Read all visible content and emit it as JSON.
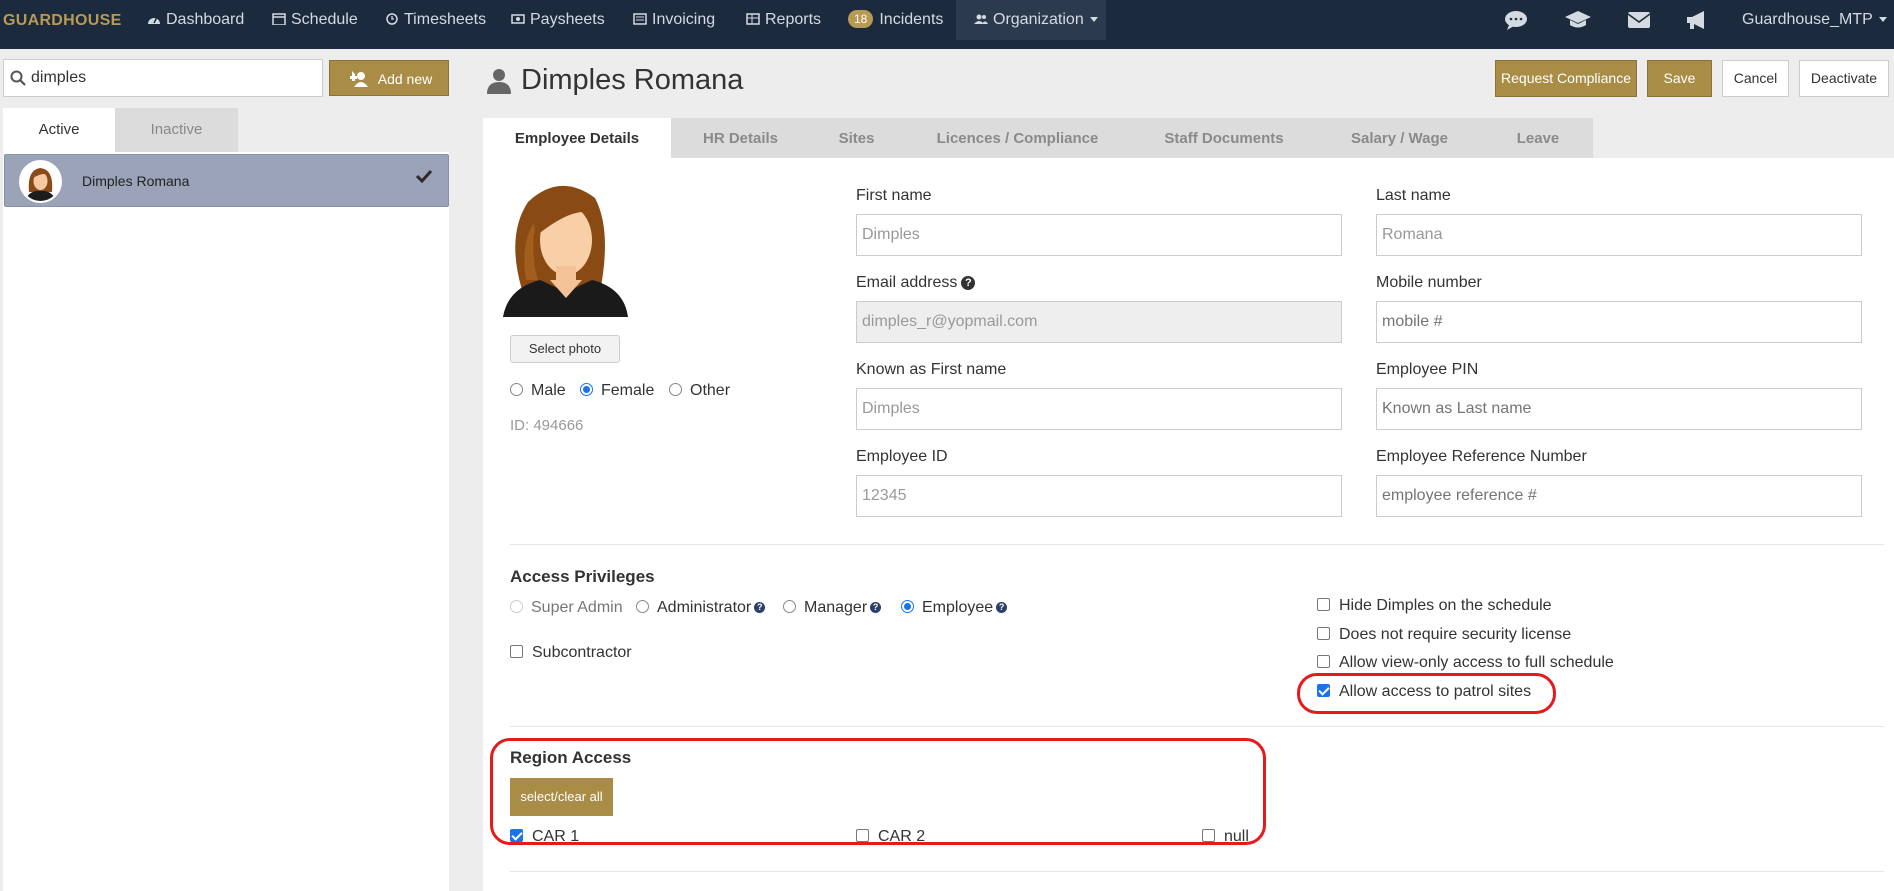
{
  "nav": {
    "brand": "GUARDHOUSE",
    "items": [
      {
        "label": "Dashboard",
        "icon": "dashboard-icon"
      },
      {
        "label": "Schedule",
        "icon": "calendar-icon"
      },
      {
        "label": "Timesheets",
        "icon": "clock-icon"
      },
      {
        "label": "Paysheets",
        "icon": "money-icon"
      },
      {
        "label": "Invoicing",
        "icon": "invoice-icon"
      },
      {
        "label": "Reports",
        "icon": "table-icon"
      },
      {
        "label": "Incidents",
        "badge": "18"
      },
      {
        "label": "Organization",
        "icon": "users-icon"
      }
    ],
    "right_icons": [
      "chat-icon",
      "graduation-cap-icon",
      "envelope-icon",
      "megaphone-icon"
    ],
    "account": "Guardhouse_MTP"
  },
  "left": {
    "search_value": "dimples",
    "add_new": "Add new",
    "tabs": {
      "active": "Active",
      "inactive": "Inactive"
    },
    "employees": [
      {
        "name": "Dimples Romana",
        "selected": true
      }
    ]
  },
  "header": {
    "title": "Dimples Romana",
    "buttons": {
      "request_compliance": "Request Compliance",
      "save": "Save",
      "cancel": "Cancel",
      "deactivate": "Deactivate"
    }
  },
  "tabs": [
    "Employee Details",
    "HR Details",
    "Sites",
    "Licences / Compliance",
    "Staff Documents",
    "Salary / Wage",
    "Leave"
  ],
  "profile": {
    "select_photo": "Select photo",
    "gender": {
      "male": "Male",
      "female": "Female",
      "other": "Other",
      "selected": "Female"
    },
    "id_text": "ID: 494666"
  },
  "form": {
    "first_name": {
      "label": "First name",
      "value": "Dimples"
    },
    "last_name": {
      "label": "Last name",
      "value": "Romana"
    },
    "email": {
      "label": "Email address",
      "value": "dimples_r@yopmail.com"
    },
    "mobile": {
      "label": "Mobile number",
      "placeholder": "mobile #"
    },
    "known_first": {
      "label": "Known as First name",
      "value": "Dimples"
    },
    "pin": {
      "label": "Employee PIN",
      "placeholder": "Known as Last name"
    },
    "employee_id": {
      "label": "Employee ID",
      "value": "12345"
    },
    "reference": {
      "label": "Employee Reference Number",
      "placeholder": "employee reference #"
    }
  },
  "access": {
    "title": "Access Privileges",
    "roles": {
      "super_admin": "Super Admin",
      "administrator": "Administrator",
      "manager": "Manager",
      "employee": "Employee",
      "selected": "Employee"
    },
    "subcontractor": "Subcontractor",
    "options": {
      "hide_schedule": "Hide Dimples on the schedule",
      "no_license": "Does not require security license",
      "view_only": "Allow view-only access to full schedule",
      "patrol": "Allow access to patrol sites"
    }
  },
  "region": {
    "title": "Region Access",
    "select_all": "select/clear all",
    "regions": [
      {
        "label": "CAR 1",
        "checked": true
      },
      {
        "label": "CAR 2",
        "checked": false
      },
      {
        "label": "null",
        "checked": false
      }
    ]
  },
  "colors": {
    "nav_bg": "#1b2a3c",
    "gold": "#a98d47",
    "highlight": "#e8181c",
    "check": "#1a73e8"
  }
}
